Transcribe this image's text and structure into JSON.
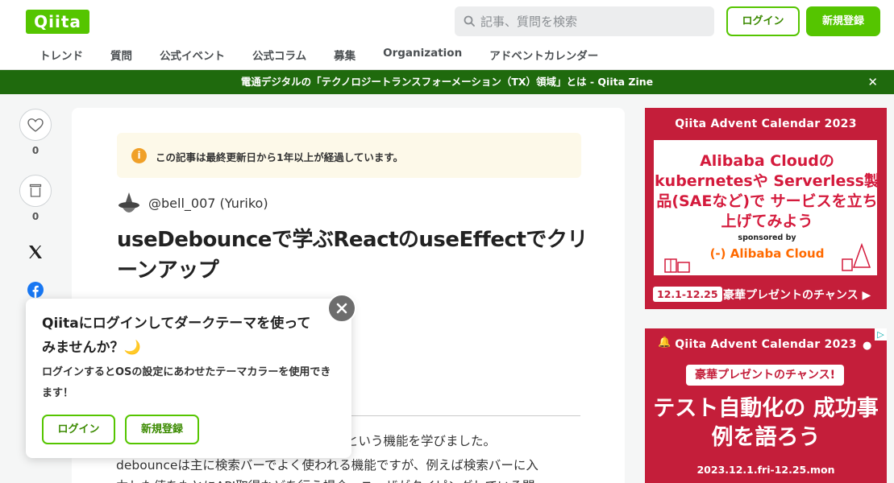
{
  "header": {
    "logo": "Qiita",
    "search_placeholder": "記事、質問を検索",
    "login_label": "ログイン",
    "signup_label": "新規登録",
    "nav": [
      "トレンド",
      "質問",
      "公式イベント",
      "公式コラム",
      "募集",
      "Organization",
      "アドベントカレンダー"
    ]
  },
  "banner": {
    "text": "電通デジタルの「テクノロジートランスフォーメーション（TX）領域」とは - Qiita Zine",
    "close": "✕"
  },
  "share": {
    "like_count": "0",
    "stock_count": "0"
  },
  "article": {
    "notice": "この記事は最終更新日から1年以上が経過しています。",
    "author": "@bell_007 (Yuriko)",
    "title": "useDebounceで学ぶReactのuseEffectでクリーンアップ",
    "body_line1": "という機能を学びました。",
    "body_line2": "debounceは主に検索バーでよく使われる機能ですが、例えば検索バーに入",
    "body_line3": "力した値をもとにAPI取得などを行う場合、ユーザがタイピングしている間"
  },
  "popup": {
    "title": "Qiitaにログインしてダークテーマを使ってみませんか？🌙",
    "description": "ログインするとOSの設定にあわせたテーマカラーを使用できます！",
    "login_label": "ログイン",
    "signup_label": "新規登録"
  },
  "ads": {
    "ad1": {
      "top": "Qiita Advent Calendar 2023",
      "headline": "Alibaba Cloudの kubernetesや Serverless製品(SAEなど)で サービスを立ち上げてみよう",
      "sponsor": "sponsored by",
      "brand": "(-) Alibaba Cloud",
      "date": "12.1-12.25",
      "cta": "豪華プレゼントのチャンス ▶"
    },
    "ad2": {
      "top": "Qiita Advent Calendar 2023",
      "badge": "豪華プレゼントのチャンス!",
      "headline": "テスト自動化の 成功事例を語ろう",
      "date": "2023.12.1.fri-12.25.mon"
    }
  },
  "colors": {
    "brand_green": "#55c500",
    "banner_green": "#1f6a0d",
    "ad_red": "#c41e3a"
  }
}
